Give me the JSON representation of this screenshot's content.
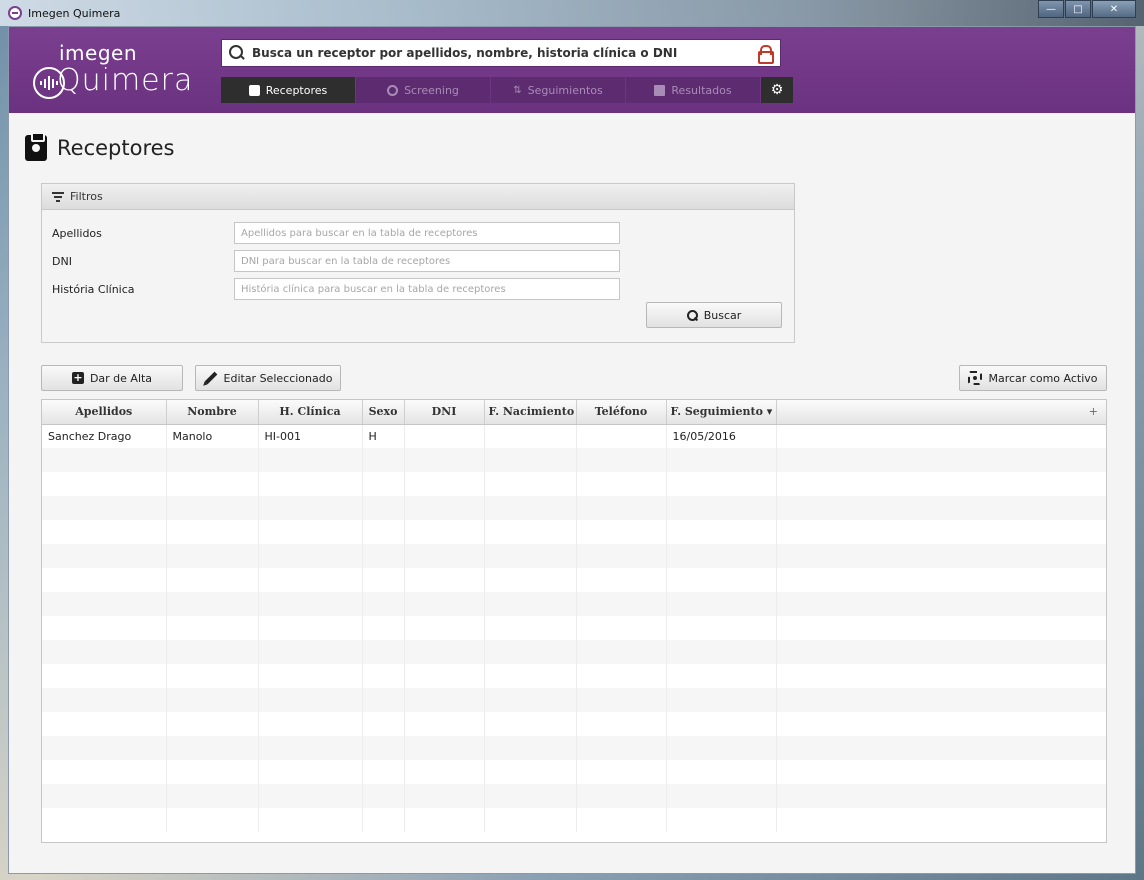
{
  "window": {
    "title": "Imegen Quimera",
    "controls": [
      "minimize",
      "maximize",
      "close"
    ]
  },
  "logo": {
    "top": "imegen",
    "bottom": "Quimera"
  },
  "search": {
    "placeholder": "Busca un receptor por apellidos, nombre, historia clínica o DNI"
  },
  "nav": {
    "tabs": [
      {
        "label": "Receptores",
        "icon": "person-badge-icon",
        "active": true
      },
      {
        "label": "Screening",
        "icon": "target-icon",
        "active": false
      },
      {
        "label": "Seguimientos",
        "icon": "sort-arrows-icon",
        "active": false
      },
      {
        "label": "Resultados",
        "icon": "chart-icon",
        "active": false
      }
    ],
    "settings_icon": "gear-icon"
  },
  "page": {
    "title": "Receptores"
  },
  "filters": {
    "header": "Filtros",
    "fields": [
      {
        "label": "Apellidos",
        "placeholder": "Apellidos para buscar en la tabla de receptores",
        "value": ""
      },
      {
        "label": "DNI",
        "placeholder": "DNI para buscar en la tabla de receptores",
        "value": ""
      },
      {
        "label": "História Clínica",
        "placeholder": "História clínica para buscar en la tabla de receptores",
        "value": ""
      }
    ],
    "search_button": "Buscar"
  },
  "actions": {
    "add": "Dar de Alta",
    "edit": "Editar Seleccionado",
    "mark_active": "Marcar como Activo"
  },
  "table": {
    "columns": [
      "Apellidos",
      "Nombre",
      "H. Clínica",
      "Sexo",
      "DNI",
      "F. Nacimiento",
      "Teléfono",
      "F. Seguimiento ▾",
      "+"
    ],
    "rows": [
      [
        "Sanchez Drago",
        "Manolo",
        "HI-001",
        "H",
        "",
        "",
        "",
        "16/05/2016",
        ""
      ]
    ]
  },
  "colors": {
    "header": "#7b3f8f",
    "active_tab": "#2e2e2e",
    "lock": "#c0392b"
  }
}
